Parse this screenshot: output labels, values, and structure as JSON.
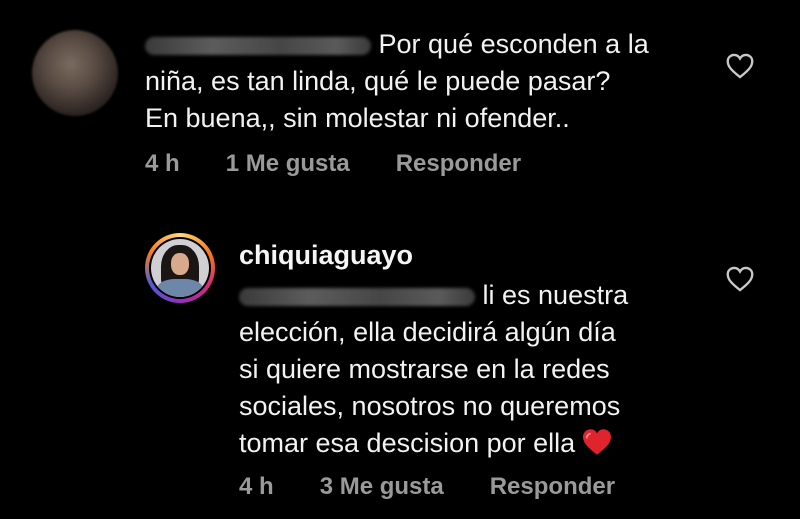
{
  "colors": {
    "background": "#000000",
    "text": "#f2f2f2",
    "meta": "#9a9a9a",
    "heart_emoji": "#e0242e",
    "story_ring": [
      "#feda75",
      "#fa7e1e",
      "#d62976",
      "#962fbf",
      "#4f5bd5"
    ]
  },
  "comments": [
    {
      "username_redacted": true,
      "avatar": "blurred-avatar",
      "lines_after_redaction": "Por qué  esconden a la",
      "line2": "niña, es tan linda, qué  le puede pasar?",
      "line3": "En buena,, sin molestar ni ofender..",
      "time": "4 h",
      "likes": "1 Me gusta",
      "reply": "Responder",
      "like_icon": "heart-outline-icon"
    },
    {
      "username": "chiquiaguayo",
      "avatar": "story-ring-avatar",
      "lines_after_redaction": "li es nuestra",
      "line2": "elección, ella decidirá algún día",
      "line3": "si quiere mostrarse en la redes",
      "line4": "sociales, nosotros no queremos",
      "line5": "tomar esa descision por ella",
      "emoji": "❤️",
      "time": "4 h",
      "likes": "3 Me gusta",
      "reply": "Responder",
      "like_icon": "heart-outline-icon"
    }
  ]
}
